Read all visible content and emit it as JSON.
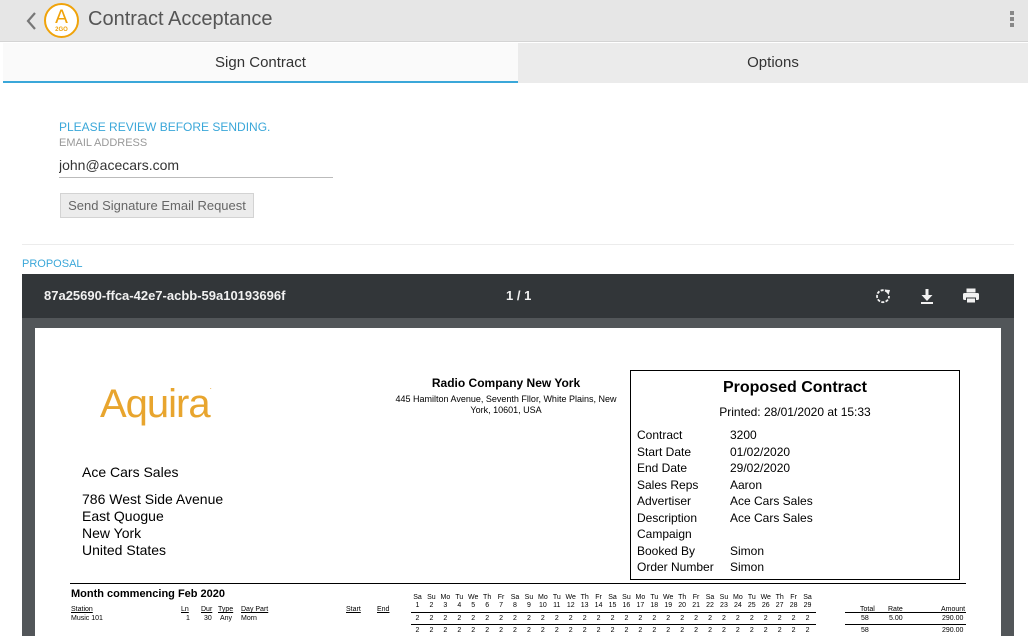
{
  "header": {
    "title": "Contract Acceptance",
    "logo_letter": "A",
    "logo_sub": "2GO"
  },
  "tabs": [
    {
      "label": "Sign Contract"
    },
    {
      "label": "Options"
    }
  ],
  "form": {
    "review_text": "PLEASE REVIEW BEFORE SENDING.",
    "email_label": "EMAIL ADDRESS",
    "email_value": "john@acecars.com",
    "send_button": "Send Signature Email Request"
  },
  "proposal_label": "PROPOSAL",
  "viewer": {
    "doc_id": "87a25690-ffca-42e7-acbb-59a10193696f",
    "page_indicator": "1 / 1",
    "icons": [
      "rotate-icon",
      "download-icon",
      "print-icon"
    ]
  },
  "document": {
    "logo_text": "Aquira",
    "logo_mark": ".",
    "company_name": "Radio Company New York",
    "company_address": "445 Hamilton Avenue, Seventh Fllor, White Plains, New York, 10601, USA",
    "recipient": {
      "name": "Ace Cars Sales",
      "address_lines": [
        "786 West Side Avenue",
        "East Quogue",
        "New York",
        "United States"
      ]
    },
    "contract_box": {
      "title": "Proposed Contract",
      "printed": "Printed: 28/01/2020 at 15:33",
      "fields": [
        {
          "key": "Contract",
          "value": "3200"
        },
        {
          "key": "Start Date",
          "value": "01/02/2020"
        },
        {
          "key": "End Date",
          "value": "29/02/2020"
        },
        {
          "key": "Sales Reps",
          "value": "Aaron"
        },
        {
          "key": "Advertiser",
          "value": "Ace Cars Sales"
        },
        {
          "key": "Description",
          "value": "Ace Cars Sales"
        },
        {
          "key": "Campaign",
          "value": ""
        },
        {
          "key": "Booked By",
          "value": "Simon"
        },
        {
          "key": "Order Number",
          "value": "Simon"
        }
      ]
    },
    "schedule": {
      "month_label": "Month commencing  Feb 2020",
      "headers": {
        "station": "Station",
        "ln": "Ln",
        "dur": "Dur",
        "type": "Type",
        "day_part": "Day Part",
        "start": "Start",
        "end": "End",
        "total": "Total",
        "rate": "Rate",
        "amount": "Amount"
      },
      "row": {
        "station": "Music 101",
        "ln": "1",
        "dur": "30",
        "type": "Any",
        "day_part": "Morn",
        "total": "58",
        "rate": "5.00",
        "amount": "290.00"
      },
      "totals_row": {
        "total": "58",
        "amount": "290.00"
      },
      "day_names": [
        "Sa",
        "Su",
        "Mo",
        "Tu",
        "We",
        "Th",
        "Fr",
        "Sa",
        "Su",
        "Mo",
        "Tu",
        "We",
        "Th",
        "Fr",
        "Sa",
        "Su",
        "Mo",
        "Tu",
        "We",
        "Th",
        "Fr",
        "Sa",
        "Su",
        "Mo",
        "Tu",
        "We",
        "Th",
        "Fr",
        "Sa"
      ],
      "day_numbers": [
        "1",
        "2",
        "3",
        "4",
        "5",
        "6",
        "7",
        "8",
        "9",
        "10",
        "11",
        "12",
        "13",
        "14",
        "15",
        "16",
        "17",
        "18",
        "19",
        "20",
        "21",
        "22",
        "23",
        "24",
        "25",
        "26",
        "27",
        "28",
        "29"
      ],
      "spots_per_day": "2"
    }
  }
}
